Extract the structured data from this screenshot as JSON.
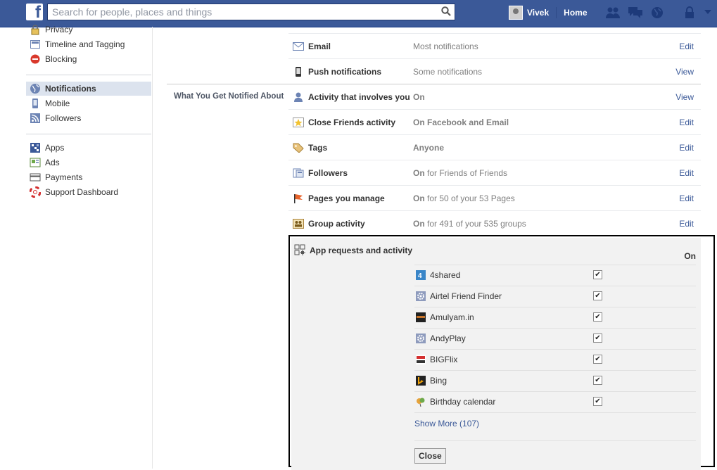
{
  "topbar": {
    "logo": "f",
    "search_placeholder": "Search for people, places and things",
    "user_name": "Vivek",
    "home_label": "Home"
  },
  "leftnav": {
    "items": [
      {
        "label": "Privacy",
        "icon": "lock-icon"
      },
      {
        "label": "Timeline and Tagging",
        "icon": "timeline-icon"
      },
      {
        "label": "Blocking",
        "icon": "blocking-icon"
      },
      {
        "label": "Notifications",
        "icon": "globe-icon",
        "active": true
      },
      {
        "label": "Mobile",
        "icon": "mobile-icon"
      },
      {
        "label": "Followers",
        "icon": "rss-icon"
      },
      {
        "label": "Apps",
        "icon": "apps-icon"
      },
      {
        "label": "Ads",
        "icon": "ads-icon"
      },
      {
        "label": "Payments",
        "icon": "credit-card-icon"
      },
      {
        "label": "Support Dashboard",
        "icon": "lifebuoy-icon"
      }
    ]
  },
  "how_rows": [
    {
      "label": "Email",
      "value": "Most notifications",
      "action": "Edit"
    },
    {
      "label": "Push notifications",
      "value": "Some notifications",
      "action": "View"
    }
  ],
  "section_title": "What You Get Notified About",
  "what_rows": [
    {
      "label": "Activity that involves you",
      "value_bold": "On",
      "value_rest": "",
      "action": "View"
    },
    {
      "label": "Close Friends activity",
      "value_bold": "On Facebook and Email",
      "value_rest": "",
      "action": "Edit"
    },
    {
      "label": "Tags",
      "value_bold": "Anyone",
      "value_rest": "",
      "action": "Edit"
    },
    {
      "label": "Followers",
      "value_bold": "On",
      "value_rest": " for Friends of Friends",
      "action": "Edit"
    },
    {
      "label": "Pages you manage",
      "value_bold": "On",
      "value_rest": " for 50 of your 53 Pages",
      "action": "Edit"
    },
    {
      "label": "Group activity",
      "value_bold": "On",
      "value_rest": " for 491 of your 535 groups",
      "action": "Edit"
    }
  ],
  "app_section": {
    "label": "App requests and activity",
    "status": "On",
    "apps": [
      {
        "name": "4shared",
        "checked": true
      },
      {
        "name": "Airtel Friend Finder",
        "checked": true
      },
      {
        "name": "Amulyam.in",
        "checked": true
      },
      {
        "name": "AndyPlay",
        "checked": true
      },
      {
        "name": "BIGFlix",
        "checked": true
      },
      {
        "name": "Bing",
        "checked": true
      },
      {
        "name": "Birthday calendar",
        "checked": true
      }
    ],
    "show_more": "Show More (107)",
    "close_label": "Close"
  },
  "colors": {
    "brand": "#3b5998",
    "link": "#3b5998",
    "active_nav": "#dce3ee"
  }
}
